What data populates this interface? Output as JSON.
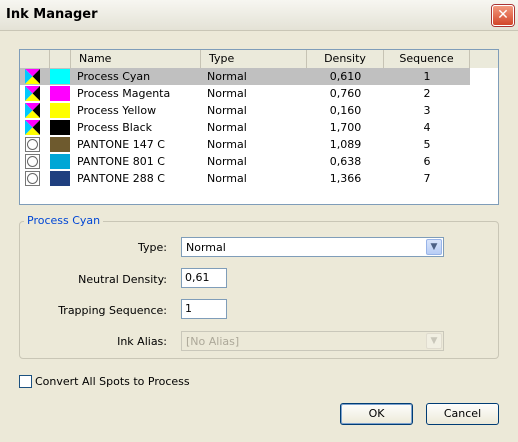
{
  "window": {
    "title": "Ink Manager",
    "close_glyph": "✕"
  },
  "inks_table": {
    "columns": [
      "Name",
      "Type",
      "Density",
      "Sequence"
    ],
    "rows": [
      {
        "name": "Process Cyan",
        "type": "Normal",
        "density": "0,610",
        "sequence": "1",
        "color": "#00ffff",
        "icon": "process-ink-icon",
        "selected": true
      },
      {
        "name": "Process Magenta",
        "type": "Normal",
        "density": "0,760",
        "sequence": "2",
        "color": "#ff00ff",
        "icon": "process-ink-icon"
      },
      {
        "name": "Process Yellow",
        "type": "Normal",
        "density": "0,160",
        "sequence": "3",
        "color": "#ffff00",
        "icon": "process-ink-icon"
      },
      {
        "name": "Process Black",
        "type": "Normal",
        "density": "1,700",
        "sequence": "4",
        "color": "#000000",
        "icon": "process-ink-icon"
      },
      {
        "name": "PANTONE 147 C",
        "type": "Normal",
        "density": "1,089",
        "sequence": "5",
        "color": "#6e5a2e",
        "icon": "spot-ink-icon"
      },
      {
        "name": "PANTONE 801 C",
        "type": "Normal",
        "density": "0,638",
        "sequence": "6",
        "color": "#00a6d6",
        "icon": "spot-ink-icon"
      },
      {
        "name": "PANTONE 288 C",
        "type": "Normal",
        "density": "1,366",
        "sequence": "7",
        "color": "#1f3f7f",
        "icon": "spot-ink-icon"
      }
    ]
  },
  "details": {
    "group_title": "Process Cyan",
    "type_label": "Type:",
    "type_value": "Normal",
    "neutral_density_label": "Neutral Density:",
    "neutral_density_value": "0,61",
    "trapping_sequence_label": "Trapping Sequence:",
    "trapping_sequence_value": "1",
    "ink_alias_label": "Ink Alias:",
    "ink_alias_value": "[No Alias]"
  },
  "convert_spots_label": "Convert All Spots to Process",
  "buttons": {
    "ok": "OK",
    "cancel": "Cancel"
  },
  "colors": {
    "selection": "#c0c0c0",
    "group_title": "#0046d5",
    "list_border": "#7f9db9"
  }
}
